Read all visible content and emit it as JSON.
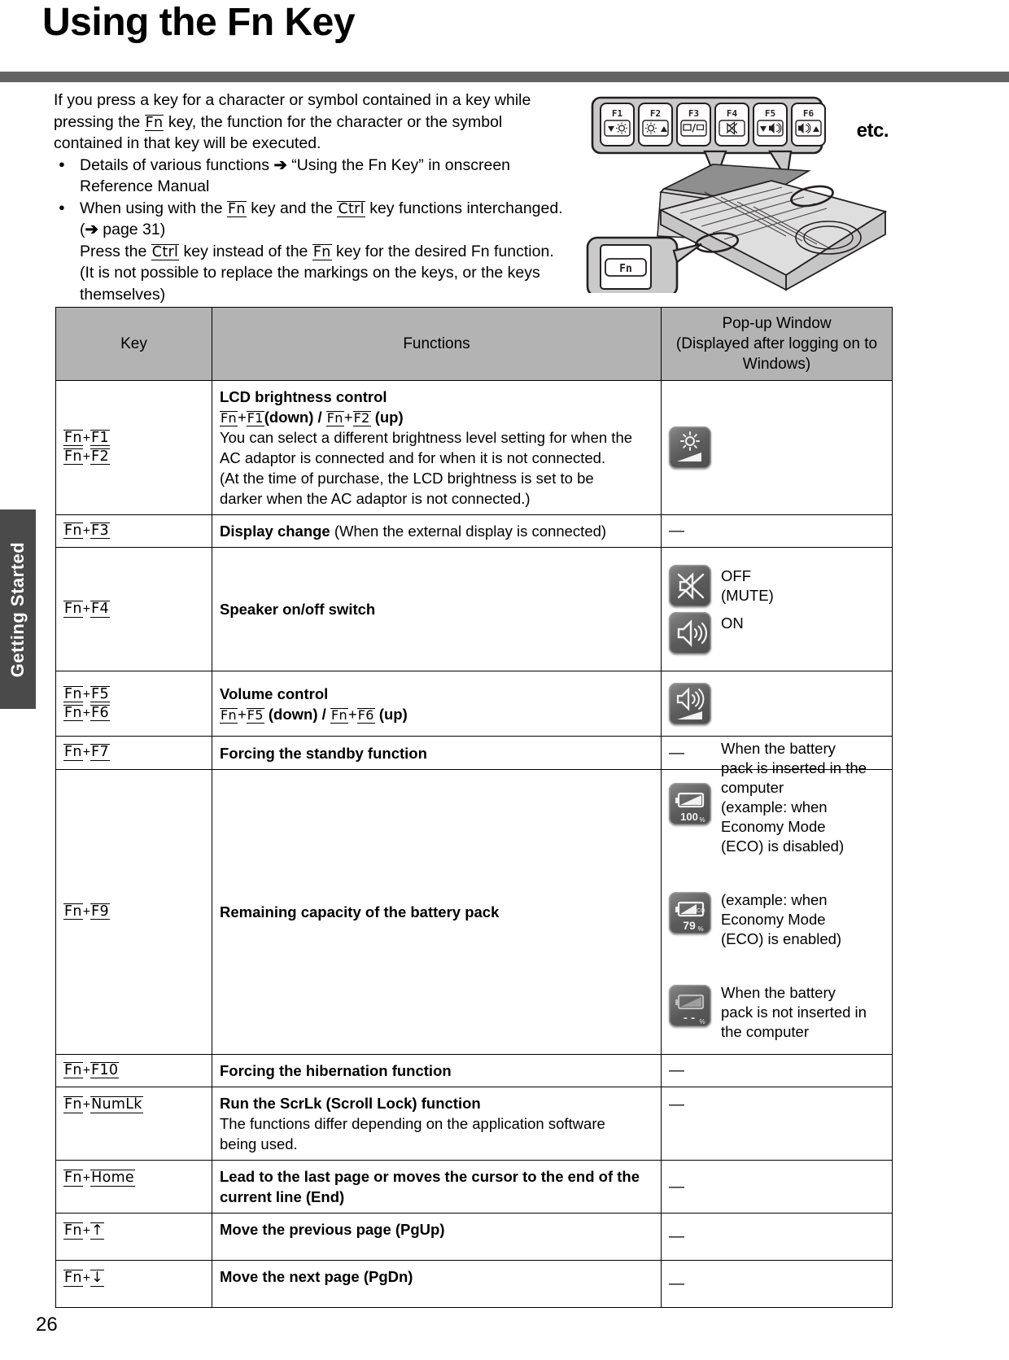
{
  "page": {
    "title": "Using the Fn Key",
    "number": "26",
    "side_tab": "Getting Started"
  },
  "intro": {
    "paragraph": "If you press a key for a character or symbol contained in a key while pressing the Fn key, the function for the character or the symbol contained in that key will be executed.",
    "para_part1": "If you press a key for a character or symbol contained in a key while pressing the ",
    "para_key": "Fn",
    "para_part2": " key, the function for the character or the symbol contained in that key will be executed.",
    "bullet1_text": "Details of various functions",
    "bullet1_arrow": "➔",
    "bullet1_tail": "“Using the Fn Key” in onscreen Reference Manual",
    "bullet2_a": "When using with the ",
    "bullet2_key1": "Fn",
    "bullet2_b": " key and the ",
    "bullet2_key2": "Ctrl",
    "bullet2_c": " key functions interchanged. (",
    "bullet2_arrow": "➔",
    "bullet2_d": " page 31)",
    "bullet2_line2_a": "Press the ",
    "bullet2_line2_key1": "Ctrl",
    "bullet2_line2_b": " key instead of the ",
    "bullet2_line2_key2": "Fn",
    "bullet2_line2_c": " key for the desired Fn function.",
    "bullet2_line3": "(It is not possible to replace the markings on the keys, or the keys themselves)"
  },
  "figure": {
    "etc_label": "etc.",
    "fn_key_label": "Fn",
    "fkeys": [
      {
        "name": "F1",
        "icon": "brightness-down-icon"
      },
      {
        "name": "F2",
        "icon": "brightness-up-icon"
      },
      {
        "name": "F3",
        "icon": "display-switch-icon"
      },
      {
        "name": "F4",
        "icon": "speaker-mute-icon"
      },
      {
        "name": "F5",
        "icon": "volume-down-icon"
      },
      {
        "name": "F6",
        "icon": "volume-up-icon"
      }
    ]
  },
  "table": {
    "headers": {
      "key": "Key",
      "functions": "Functions",
      "popup_line1": "Pop-up Window",
      "popup_line2": "(Displayed after logging on to",
      "popup_line3": "Windows)"
    },
    "rows": [
      {
        "keys": [
          "Fn+F1",
          "Fn+F2"
        ],
        "key_parts": [
          [
            "Fn",
            "F1"
          ],
          [
            "Fn",
            "F2"
          ]
        ],
        "func_title": "LCD brightness control",
        "func_keyline": {
          "a_fn": "Fn",
          "a_f": "F1",
          "a_suffix": "(down) /",
          "b_fn": "Fn",
          "b_f": "F2",
          "b_suffix": "(up)"
        },
        "func_body": [
          "You can select a different brightness level setting for when the",
          "AC adaptor is connected and for when it is not connected.",
          "(At the time of purchase, the LCD brightness is set to be",
          "darker when the AC adaptor is not connected.)"
        ],
        "popup_type": "icon",
        "popup_icons": [
          {
            "icon": "brightness-popup-icon",
            "label": ""
          }
        ]
      },
      {
        "keys": [
          "Fn+F3"
        ],
        "key_parts": [
          [
            "Fn",
            "F3"
          ]
        ],
        "func_bold": "Display change",
        "func_rest": " (When the external display is connected)",
        "popup_type": "dash",
        "popup_dash": "—"
      },
      {
        "keys": [
          "Fn+F4"
        ],
        "key_parts": [
          [
            "Fn",
            "F4"
          ]
        ],
        "func_bold": "Speaker on/off switch",
        "popup_type": "icons_labeled",
        "popup_icons": [
          {
            "icon": "speaker-mute-popup-icon",
            "label_lines": [
              "OFF",
              "(MUTE)"
            ]
          },
          {
            "icon": "speaker-on-popup-icon",
            "label_lines": [
              "ON"
            ]
          }
        ]
      },
      {
        "keys": [
          "Fn+F5",
          "Fn+F6"
        ],
        "key_parts": [
          [
            "Fn",
            "F5"
          ],
          [
            "Fn",
            "F6"
          ]
        ],
        "func_title": "Volume control",
        "func_keyline": {
          "a_fn": "Fn",
          "a_f": "F5",
          "a_suffix": "(down) /",
          "b_fn": "Fn",
          "b_f": "F6",
          "b_suffix": "(up)"
        },
        "popup_type": "icon",
        "popup_icons": [
          {
            "icon": "volume-popup-icon",
            "label": ""
          }
        ]
      },
      {
        "keys": [
          "Fn+F7"
        ],
        "key_parts": [
          [
            "Fn",
            "F7"
          ]
        ],
        "func_bold": "Forcing the standby function",
        "popup_type": "dash",
        "popup_dash": "—"
      },
      {
        "keys": [
          "Fn+F9"
        ],
        "key_parts": [
          [
            "Fn",
            "F9"
          ]
        ],
        "func_bold": "Remaining capacity of the battery pack",
        "popup_type": "battery",
        "popup_icons": [
          {
            "icon": "battery-100-icon",
            "value": "100",
            "unit": "%",
            "label_lines": [
              "When the battery",
              "pack is inserted in the",
              "computer",
              "(example: when",
              "Economy Mode",
              "(ECO) is disabled)"
            ]
          },
          {
            "icon": "battery-79-eco-icon",
            "value": "79",
            "unit": "%",
            "label_lines": [
              "(example: when",
              "Economy Mode",
              "(ECO) is enabled)"
            ]
          },
          {
            "icon": "battery-none-icon",
            "value": "- -",
            "unit": "%",
            "label_lines": [
              "When the battery",
              "pack is not inserted in",
              "the computer"
            ]
          }
        ]
      },
      {
        "keys": [
          "Fn+F10"
        ],
        "key_parts": [
          [
            "Fn",
            "F10"
          ]
        ],
        "func_bold": "Forcing the hibernation function",
        "popup_type": "dash",
        "popup_dash": "—"
      },
      {
        "keys": [
          "Fn+NumLk"
        ],
        "key_parts": [
          [
            "Fn",
            "NumLk"
          ]
        ],
        "func_bold": "Run the ScrLk (Scroll Lock) function",
        "func_body": [
          "The functions differ depending on the application software",
          "being used."
        ],
        "popup_type": "dash",
        "popup_dash": "—"
      },
      {
        "keys": [
          "Fn+Home"
        ],
        "key_parts": [
          [
            "Fn",
            "Home"
          ]
        ],
        "func_bold": "Lead to the last page or moves the cursor to the end of the current line (End)",
        "popup_type": "dash",
        "popup_dash": "—"
      },
      {
        "keys": [
          "Fn+↑"
        ],
        "key_parts": [
          [
            "Fn",
            "↑"
          ]
        ],
        "func_bold": "Move the previous page (PgUp)",
        "popup_type": "dash",
        "popup_dash": "—"
      },
      {
        "keys": [
          "Fn+↓"
        ],
        "key_parts": [
          [
            "Fn",
            "↓"
          ]
        ],
        "func_bold": "Move the next page (PgDn)",
        "popup_type": "dash",
        "popup_dash": "—"
      }
    ]
  },
  "colors": {
    "rule": "#636363",
    "side_tab": "#4a4a4a",
    "table_header": "#b3b3b3",
    "icon_dark": "#555555"
  }
}
